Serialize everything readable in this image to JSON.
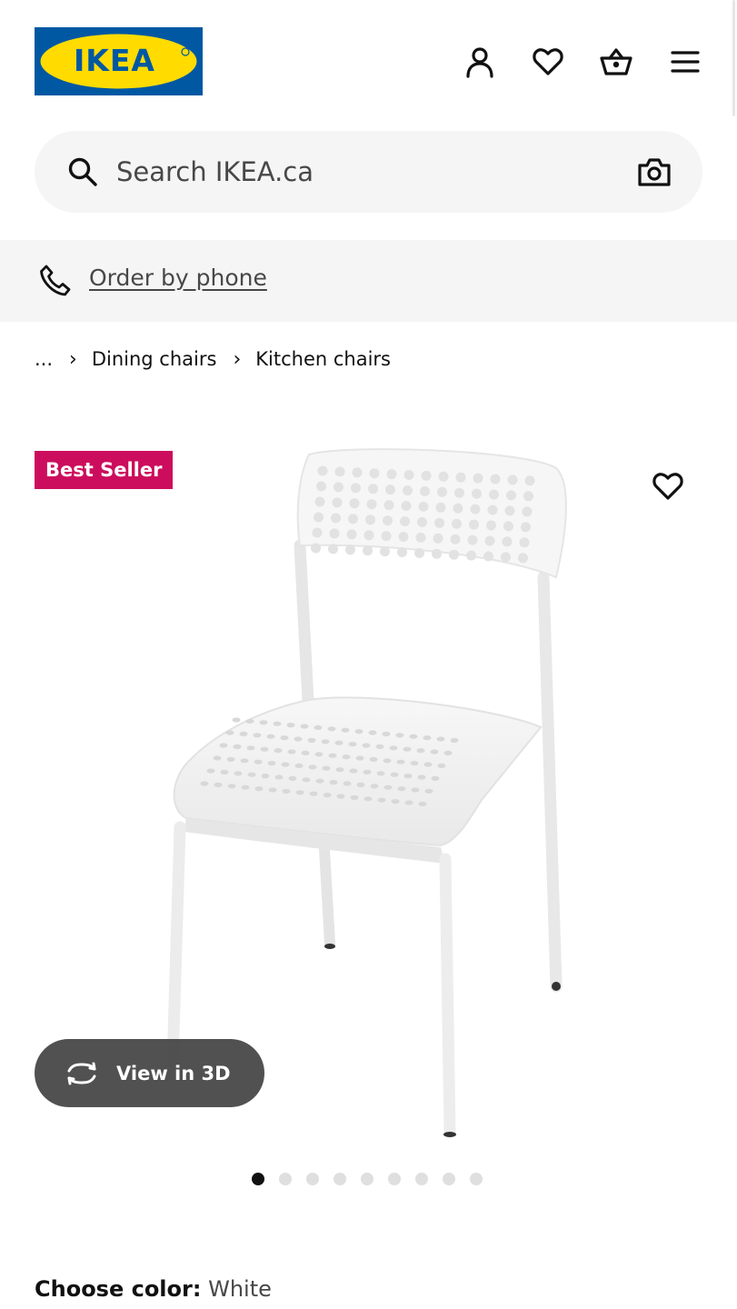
{
  "header": {
    "logo_text": "IKEA",
    "icons": [
      "account-icon",
      "wishlist-heart-icon",
      "shopping-bag-icon",
      "menu-icon"
    ]
  },
  "search": {
    "placeholder": "Search IKEA.ca",
    "icons": [
      "search-icon",
      "camera-icon"
    ]
  },
  "phone_bar": {
    "link_label": "Order by phone",
    "icon": "phone-icon"
  },
  "breadcrumb": {
    "ellipsis": "...",
    "items": [
      "Dining chairs",
      "Kitchen chairs"
    ]
  },
  "product": {
    "badge": "Best Seller",
    "view_3d_label": "View in 3D",
    "image_dots_total": 9,
    "image_dots_active": 0,
    "color_label": "Choose color:",
    "color_value": "White"
  },
  "colors": {
    "logo_blue": "#0058a3",
    "logo_yellow": "#ffdb00",
    "badge": "#cc0d5d",
    "view3d_bg": "#484848"
  }
}
